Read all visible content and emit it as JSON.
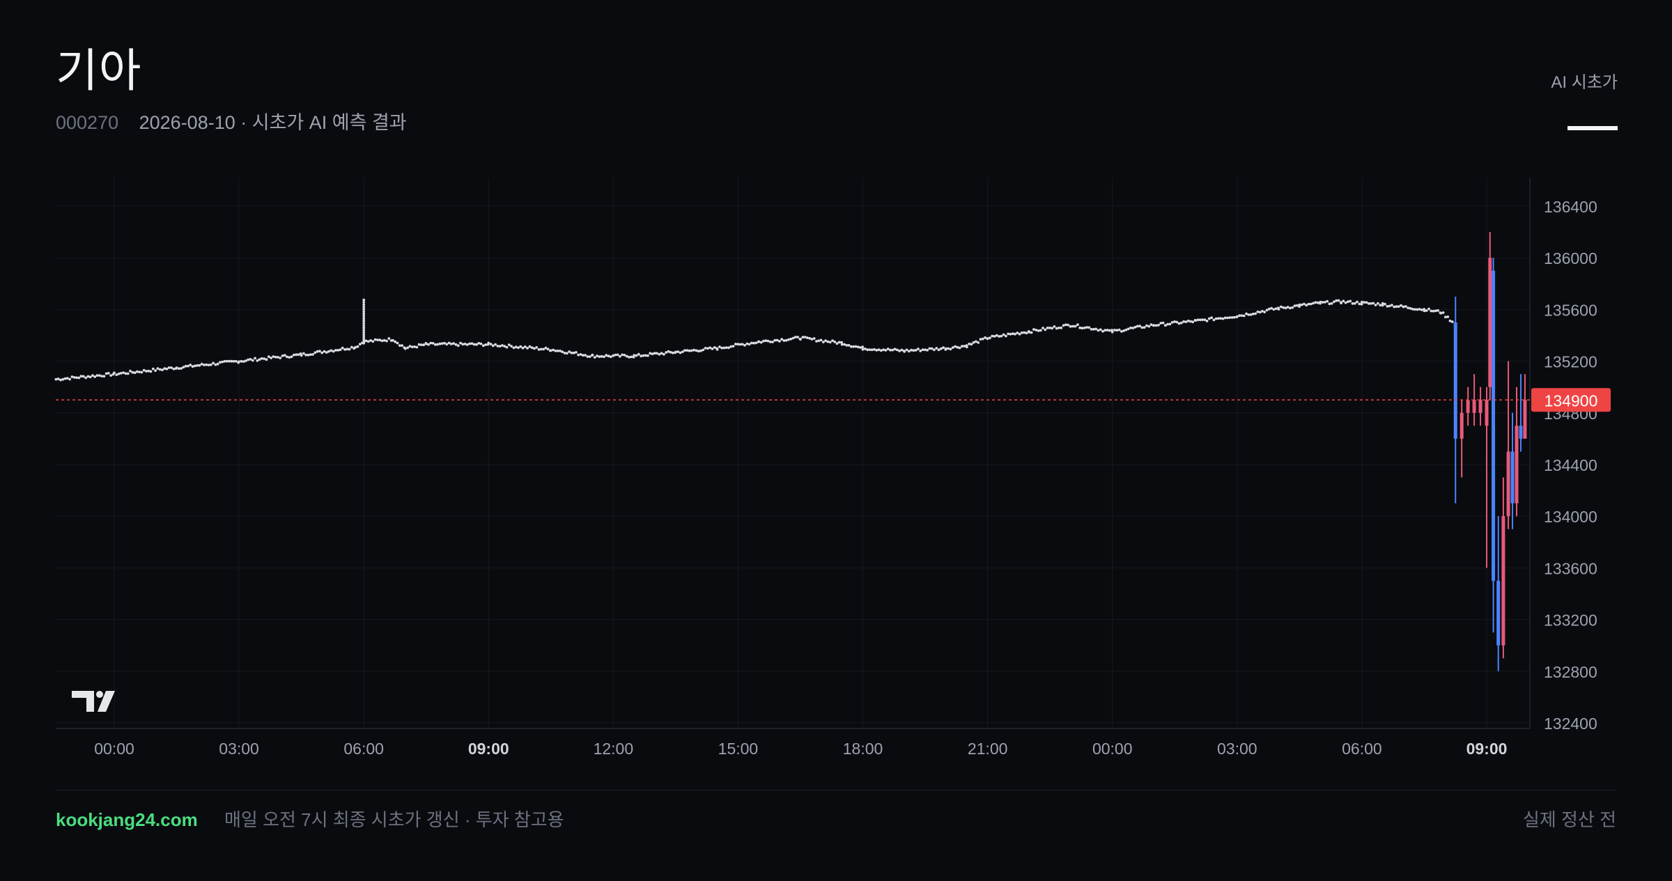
{
  "header": {
    "title": "기아",
    "ticker": "000270",
    "subtitle": "2026-08-10 · 시초가 AI 예측 결과",
    "tab_label": "AI 시초가"
  },
  "footer": {
    "brand": "kookjang24.com",
    "note": "매일 오전 7시 최종 시초가 갱신 · 투자 참고용",
    "status": "실제 정산 전"
  },
  "colors": {
    "background": "#0a0b0f",
    "grid": "#16191f",
    "dots": "#d9dbe0",
    "up": "#ef5350",
    "down": "#4a84ff",
    "candle_pink": "#e85a7a",
    "price_line": "#ef4444",
    "brand": "#4ade80"
  },
  "icons": {
    "watermark": "tradingview-logo-icon"
  },
  "chart_data": {
    "type": "line",
    "style": "dotted premarket line with live candlestick segment",
    "y_ticks": [
      136400,
      136000,
      135600,
      135200,
      134800,
      134400,
      134000,
      133600,
      133200,
      132800,
      132400
    ],
    "ylim": [
      132400,
      136500
    ],
    "x_ticks": [
      {
        "label": "00:00",
        "t": 0,
        "bold": false
      },
      {
        "label": "03:00",
        "t": 3,
        "bold": false
      },
      {
        "label": "06:00",
        "t": 6,
        "bold": false
      },
      {
        "label": "09:00",
        "t": 9,
        "bold": true
      },
      {
        "label": "12:00",
        "t": 12,
        "bold": false
      },
      {
        "label": "15:00",
        "t": 15,
        "bold": false
      },
      {
        "label": "18:00",
        "t": 18,
        "bold": false
      },
      {
        "label": "21:00",
        "t": 21,
        "bold": false
      },
      {
        "label": "00:00",
        "t": 24,
        "bold": false
      },
      {
        "label": "03:00",
        "t": 27,
        "bold": false
      },
      {
        "label": "06:00",
        "t": 30,
        "bold": false
      },
      {
        "label": "09:00",
        "t": 33,
        "bold": true
      }
    ],
    "xlim": [
      -1.4,
      34.1
    ],
    "grid": true,
    "current_price": 134900,
    "current_price_label": "134900",
    "line_series": {
      "name": "",
      "x": [
        -1.4,
        0,
        1.5,
        3,
        4.5,
        5.8,
        6.0,
        6.7,
        7.0,
        7.5,
        9,
        10.5,
        11.5,
        12.5,
        13.5,
        14.5,
        15.5,
        16.5,
        17.5,
        18,
        19,
        20,
        20.5,
        21,
        22,
        23,
        24,
        25,
        26,
        27,
        28,
        28.5,
        29,
        29.5,
        30,
        30.5,
        31,
        31.5,
        31.9,
        32.2
      ],
      "y": [
        135060,
        135100,
        135150,
        135200,
        135250,
        135310,
        135350,
        135370,
        135300,
        135330,
        135330,
        135290,
        135240,
        135240,
        135270,
        135300,
        135350,
        135380,
        135340,
        135300,
        135280,
        135300,
        135320,
        135380,
        135430,
        135480,
        135430,
        135480,
        135510,
        135550,
        135610,
        135630,
        135650,
        135660,
        135650,
        135640,
        135620,
        135600,
        135580,
        135500
      ]
    },
    "spike": {
      "x": 6.0,
      "y_from": 135350,
      "y_to": 135690
    },
    "candles": [
      {
        "t": 32.25,
        "o": 135500,
        "h": 135700,
        "l": 134100,
        "c": 134600,
        "dir": "down"
      },
      {
        "t": 32.4,
        "o": 134600,
        "h": 134900,
        "l": 134300,
        "c": 134800,
        "dir": "up"
      },
      {
        "t": 32.55,
        "o": 134800,
        "h": 135000,
        "l": 134700,
        "c": 134900,
        "dir": "up"
      },
      {
        "t": 32.7,
        "o": 134900,
        "h": 135100,
        "l": 134700,
        "c": 134800,
        "dir": "up"
      },
      {
        "t": 32.85,
        "o": 134800,
        "h": 135000,
        "l": 134700,
        "c": 134900,
        "dir": "up"
      },
      {
        "t": 33.0,
        "o": 134900,
        "h": 135000,
        "l": 133600,
        "c": 134700,
        "dir": "up"
      },
      {
        "t": 33.08,
        "o": 135000,
        "h": 136200,
        "l": 134900,
        "c": 136000,
        "dir": "up"
      },
      {
        "t": 33.16,
        "o": 135900,
        "h": 136000,
        "l": 133100,
        "c": 133500,
        "dir": "down"
      },
      {
        "t": 33.28,
        "o": 133500,
        "h": 134000,
        "l": 132800,
        "c": 133000,
        "dir": "down"
      },
      {
        "t": 33.4,
        "o": 133000,
        "h": 134300,
        "l": 132900,
        "c": 134000,
        "dir": "up"
      },
      {
        "t": 33.52,
        "o": 134000,
        "h": 135200,
        "l": 133900,
        "c": 134500,
        "dir": "up"
      },
      {
        "t": 33.62,
        "o": 134500,
        "h": 134800,
        "l": 133900,
        "c": 134100,
        "dir": "down"
      },
      {
        "t": 33.72,
        "o": 134100,
        "h": 135000,
        "l": 134000,
        "c": 134700,
        "dir": "up"
      },
      {
        "t": 33.82,
        "o": 134700,
        "h": 135100,
        "l": 134500,
        "c": 134600,
        "dir": "down"
      },
      {
        "t": 33.92,
        "o": 134600,
        "h": 135100,
        "l": 134600,
        "c": 134900,
        "dir": "up"
      }
    ]
  }
}
